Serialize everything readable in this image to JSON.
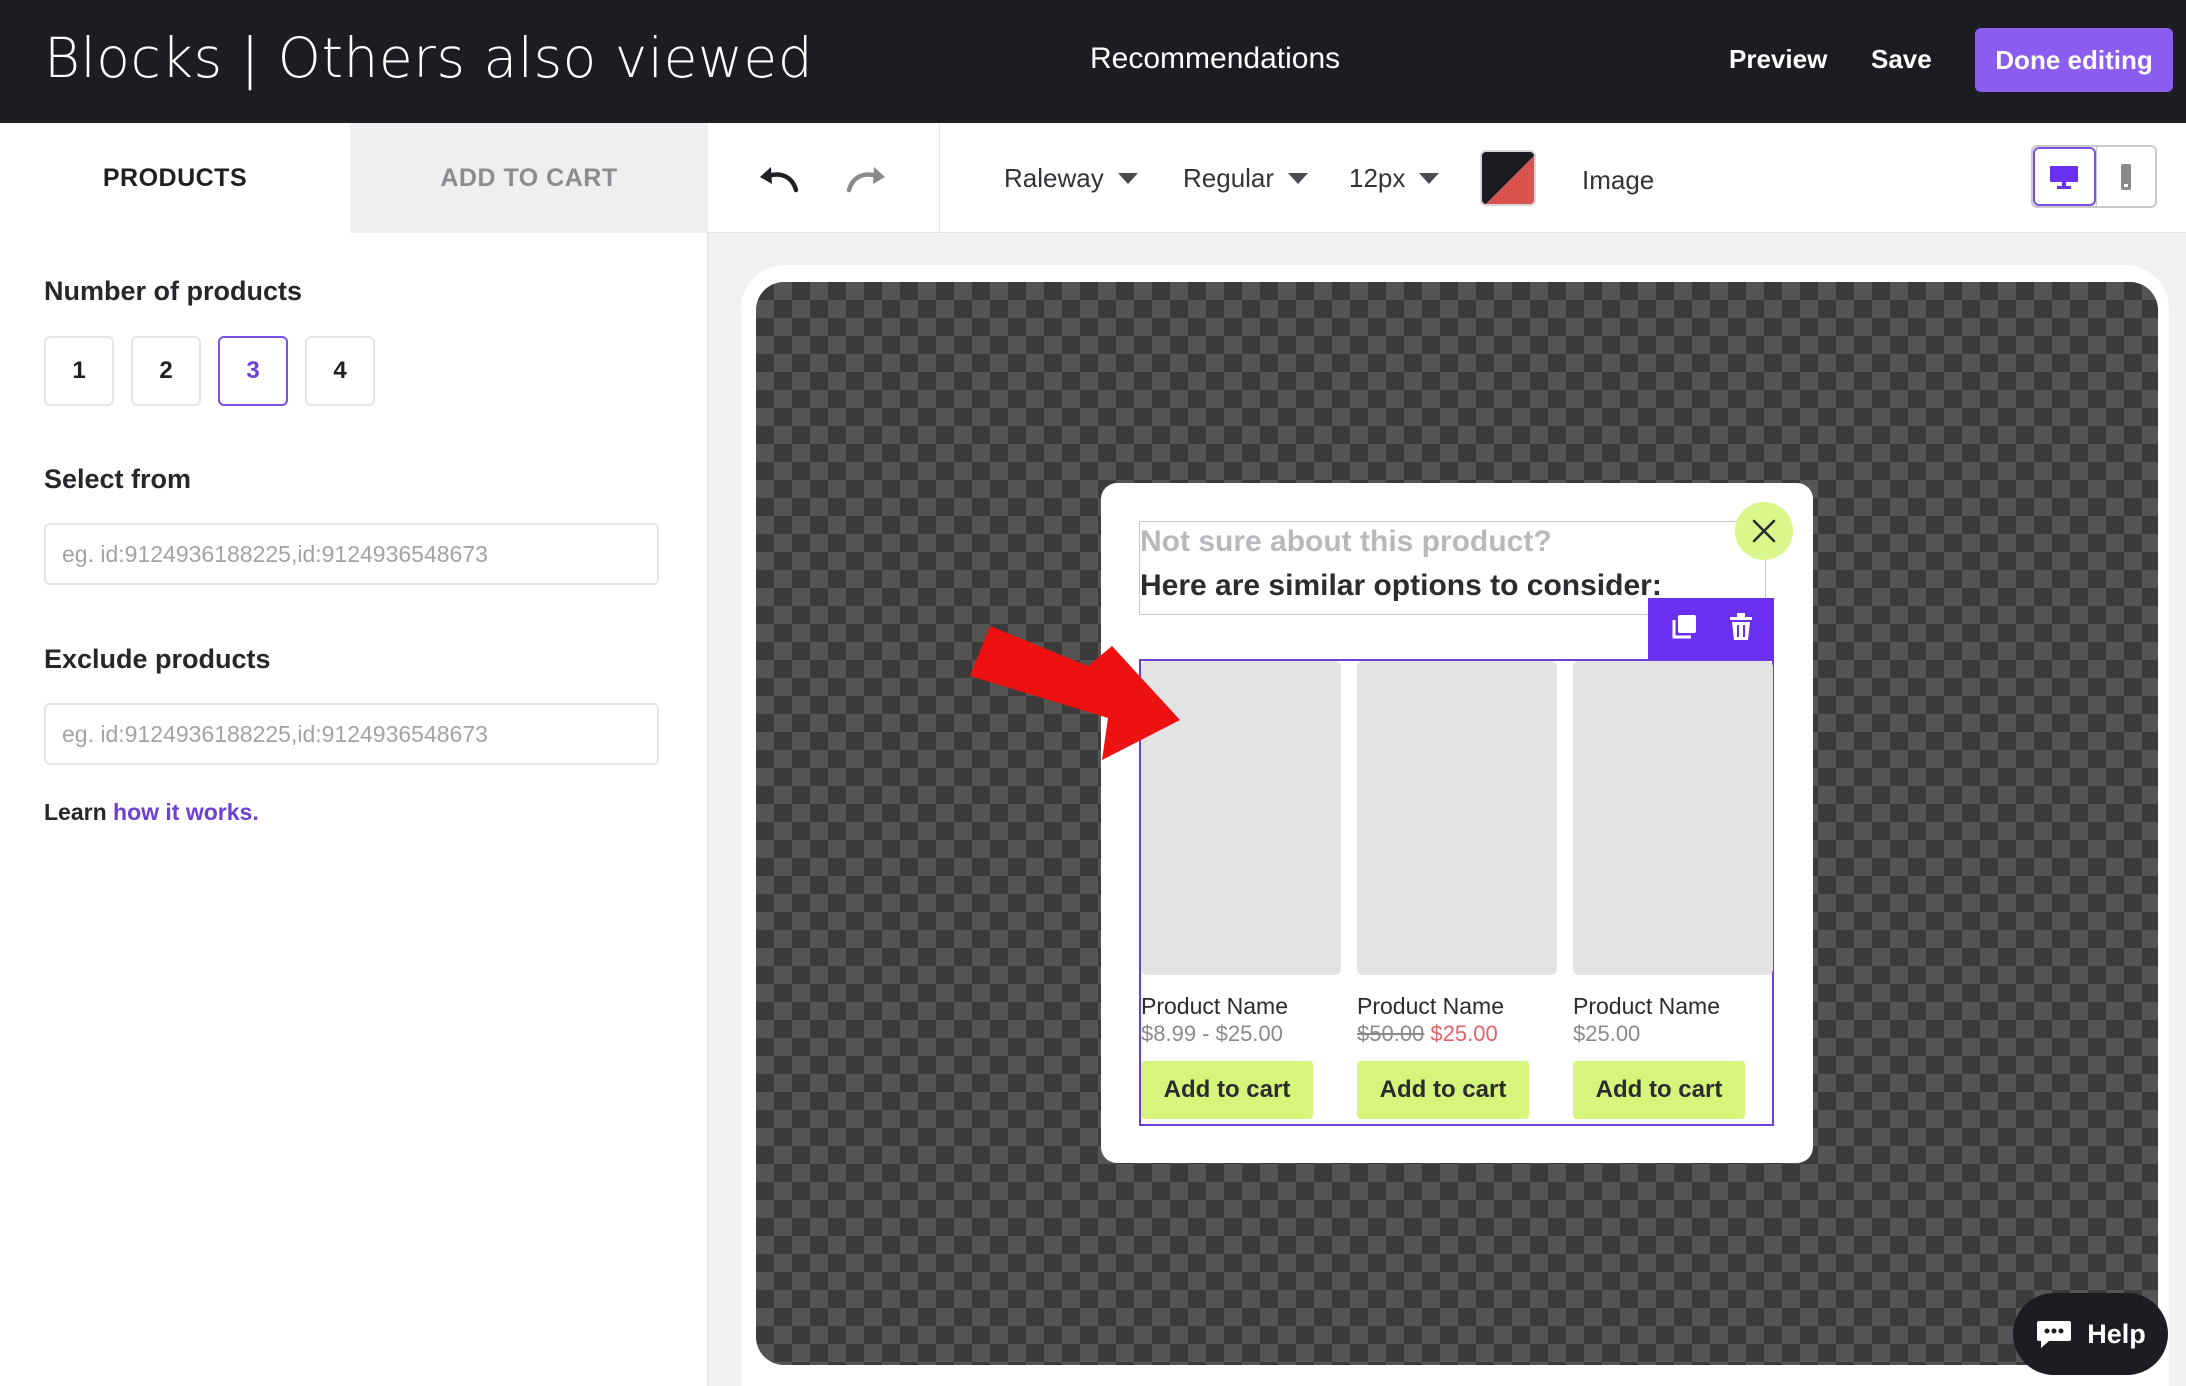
{
  "header": {
    "title": "Blocks | Others also viewed",
    "center_label": "Recommendations",
    "preview_label": "Preview",
    "save_label": "Save",
    "done_label": "Done editing",
    "accent_color": "#8b5cf0"
  },
  "left_panel": {
    "tabs": [
      {
        "label": "PRODUCTS",
        "active": true
      },
      {
        "label": "ADD TO CART",
        "active": false
      }
    ],
    "number_of_products": {
      "label": "Number of products",
      "options": [
        "1",
        "2",
        "3",
        "4"
      ],
      "selected": "3"
    },
    "select_from": {
      "label": "Select from",
      "placeholder": "eg. id:9124936188225,id:9124936548673"
    },
    "exclude_products": {
      "label": "Exclude products",
      "placeholder": "eg. id:9124936188225,id:9124936548673"
    },
    "learn": {
      "prefix": "Learn",
      "link_text": "how it works."
    }
  },
  "toolbar": {
    "undo_icon": "undo-icon",
    "redo_icon": "redo-icon",
    "font_family": "Raleway",
    "font_weight": "Regular",
    "font_size": "12px",
    "color_swatch": [
      "#1c1d22",
      "#d9534f"
    ],
    "image_label": "Image",
    "device_modes": [
      "desktop",
      "mobile"
    ],
    "selected_device": "desktop"
  },
  "popup": {
    "heading_line1": "Not sure about this product?",
    "heading_line2": "Here are similar options to consider:",
    "products": [
      {
        "name": "Product Name",
        "price": "$8.99 - $25.00",
        "old_price": "",
        "sale_price": "",
        "button": "Add to cart"
      },
      {
        "name": "Product Name",
        "price": "",
        "old_price": "$50.00",
        "sale_price": "$25.00",
        "button": "Add to cart"
      },
      {
        "name": "Product Name",
        "price": "$25.00",
        "old_price": "",
        "sale_price": "",
        "button": "Add to cart"
      }
    ],
    "button_color": "#d6f57b",
    "close_color": "#dbf68a",
    "selection_color": "#6a2ff0"
  },
  "help": {
    "label": "Help"
  }
}
